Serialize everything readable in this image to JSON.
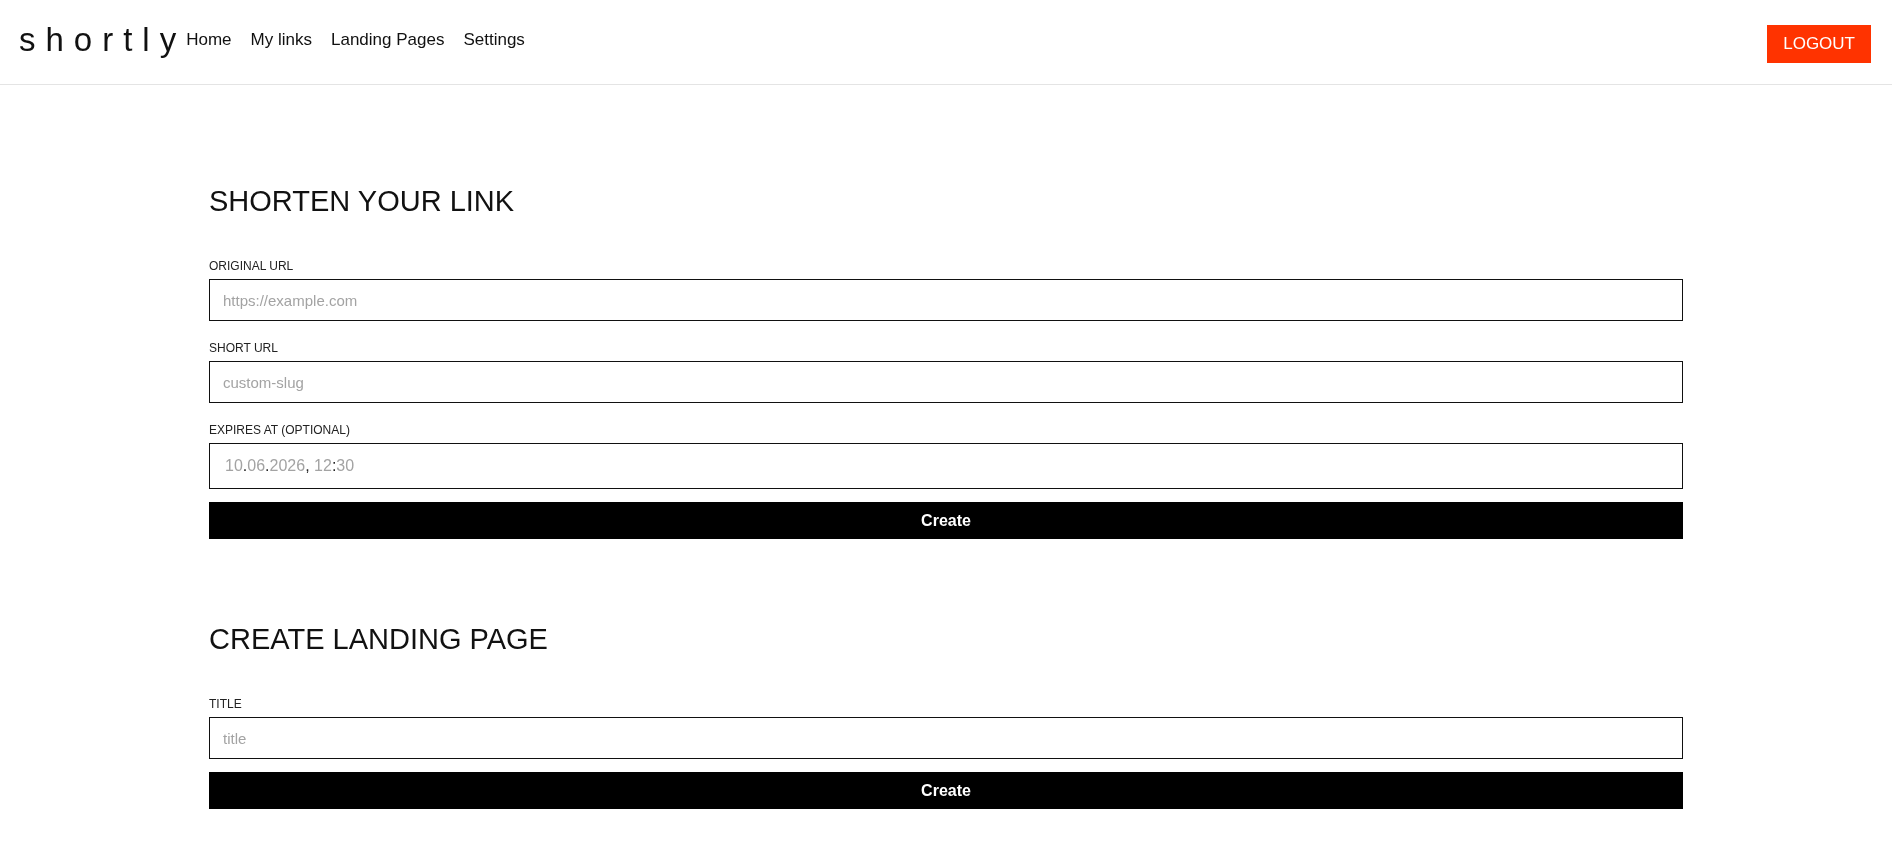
{
  "header": {
    "logo": "shortly",
    "nav": [
      "Home",
      "My links",
      "Landing Pages",
      "Settings"
    ],
    "logout": "LOGOUT"
  },
  "sections": [
    {
      "title": "SHORTEN YOUR LINK",
      "fields": [
        {
          "kind": "text",
          "label": "ORIGINAL URL",
          "placeholder": "https://example.com"
        },
        {
          "kind": "text",
          "label": "SHORT URL",
          "placeholder": "custom-slug"
        },
        {
          "kind": "datetime",
          "label": "EXPIRES AT (OPTIONAL)",
          "placeholder": "10.06.2026, 12:30"
        }
      ],
      "button": "Create"
    },
    {
      "title": "CREATE LANDING PAGE",
      "fields": [
        {
          "kind": "text",
          "label": "TITLE",
          "placeholder": "title"
        }
      ],
      "button": "Create"
    }
  ]
}
